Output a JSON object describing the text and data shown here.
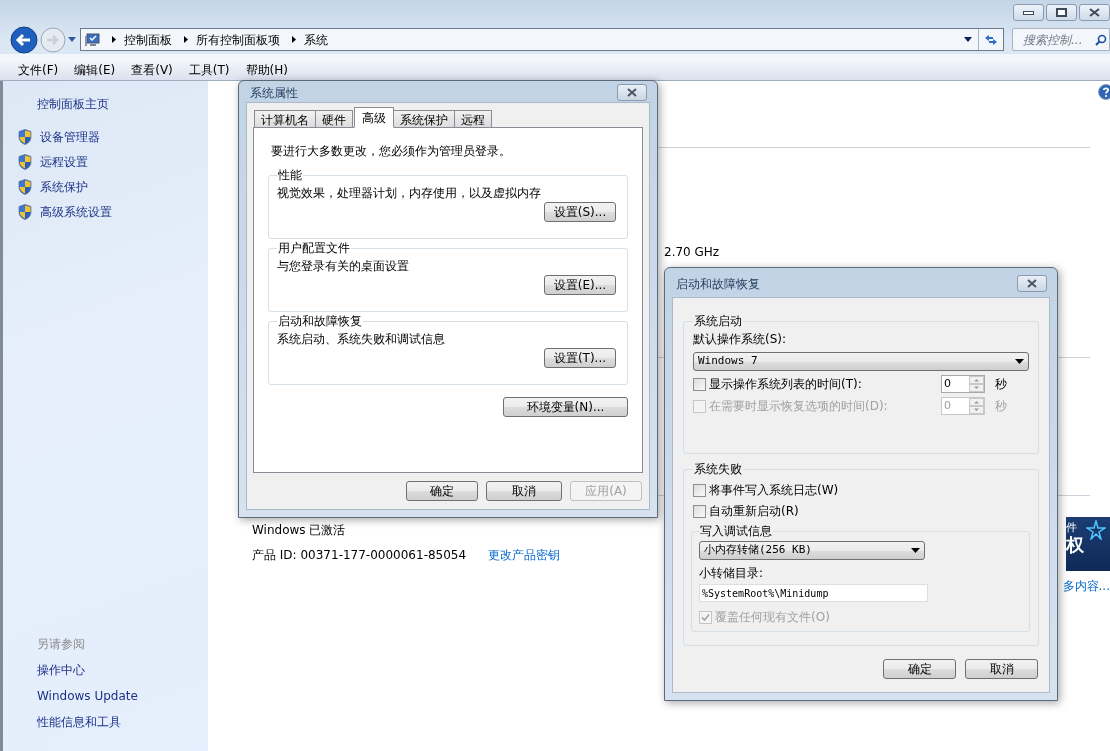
{
  "address_bar": {
    "path": [
      "控制面板",
      "所有控制面板项",
      "系统"
    ]
  },
  "search": {
    "placeholder": "搜索控制..."
  },
  "menu": [
    "文件(F)",
    "编辑(E)",
    "查看(V)",
    "工具(T)",
    "帮助(H)"
  ],
  "sidebar": {
    "home": "控制面板主页",
    "tasks": [
      "设备管理器",
      "远程设置",
      "系统保护",
      "高级系统设置"
    ],
    "see_also_title": "另请参阅",
    "see_also": [
      "操作中心",
      "Windows Update",
      "性能信息和工具"
    ]
  },
  "main": {
    "cpu_fragment": "2.70 GHz",
    "activation": "Windows 已激活",
    "product_id": "产品 ID: 00371-177-0000061-85054",
    "change_key_link": "更改产品密钥",
    "logo_fragments": [
      "件",
      "权"
    ],
    "more_link": "多内容..."
  },
  "system_properties": {
    "title": "系统属性",
    "tabs": [
      {
        "label": "计算机名",
        "selected": false
      },
      {
        "label": "硬件",
        "selected": false
      },
      {
        "label": "高级",
        "selected": true
      },
      {
        "label": "系统保护",
        "selected": false
      },
      {
        "label": "远程",
        "selected": false
      }
    ],
    "notice": "要进行大多数更改，您必须作为管理员登录。",
    "groups": [
      {
        "title": "性能",
        "description": "视觉效果，处理器计划，内存使用，以及虚拟内存",
        "button": "设置(S)..."
      },
      {
        "title": "用户配置文件",
        "description": "与您登录有关的桌面设置",
        "button": "设置(E)..."
      },
      {
        "title": "启动和故障恢复",
        "description": "系统启动、系统失败和调试信息",
        "button": "设置(T)..."
      }
    ],
    "env_button": "环境变量(N)...",
    "buttons": [
      {
        "label": "确定",
        "disabled": false
      },
      {
        "label": "取消",
        "disabled": false
      },
      {
        "label": "应用(A)",
        "disabled": true
      }
    ]
  },
  "startup_recovery": {
    "title": "启动和故障恢复",
    "startup": {
      "title": "系统启动",
      "default_os_label": "默认操作系统(S):",
      "default_os": "Windows 7",
      "options": [
        {
          "label": "显示操作系统列表的时间(T):",
          "checked": false,
          "disabled": false,
          "value": "0",
          "unit": "秒"
        },
        {
          "label": "在需要时显示恢复选项的时间(D):",
          "checked": false,
          "disabled": true,
          "value": "0",
          "unit": "秒"
        }
      ]
    },
    "failure": {
      "title": "系统失败",
      "options": [
        {
          "label": "将事件写入系统日志(W)",
          "checked": false
        },
        {
          "label": "自动重新启动(R)",
          "checked": false
        }
      ],
      "debug": {
        "title": "写入调试信息",
        "type": "小内存转储(256 KB)",
        "dir_label": "小转储目录:",
        "dir": "%SystemRoot%\\Minidump",
        "overwrite": {
          "label": "覆盖任何现有文件(O)",
          "checked": true,
          "disabled": true
        }
      }
    },
    "buttons": [
      {
        "label": "确定",
        "disabled": false
      },
      {
        "label": "取消",
        "disabled": false
      }
    ]
  }
}
